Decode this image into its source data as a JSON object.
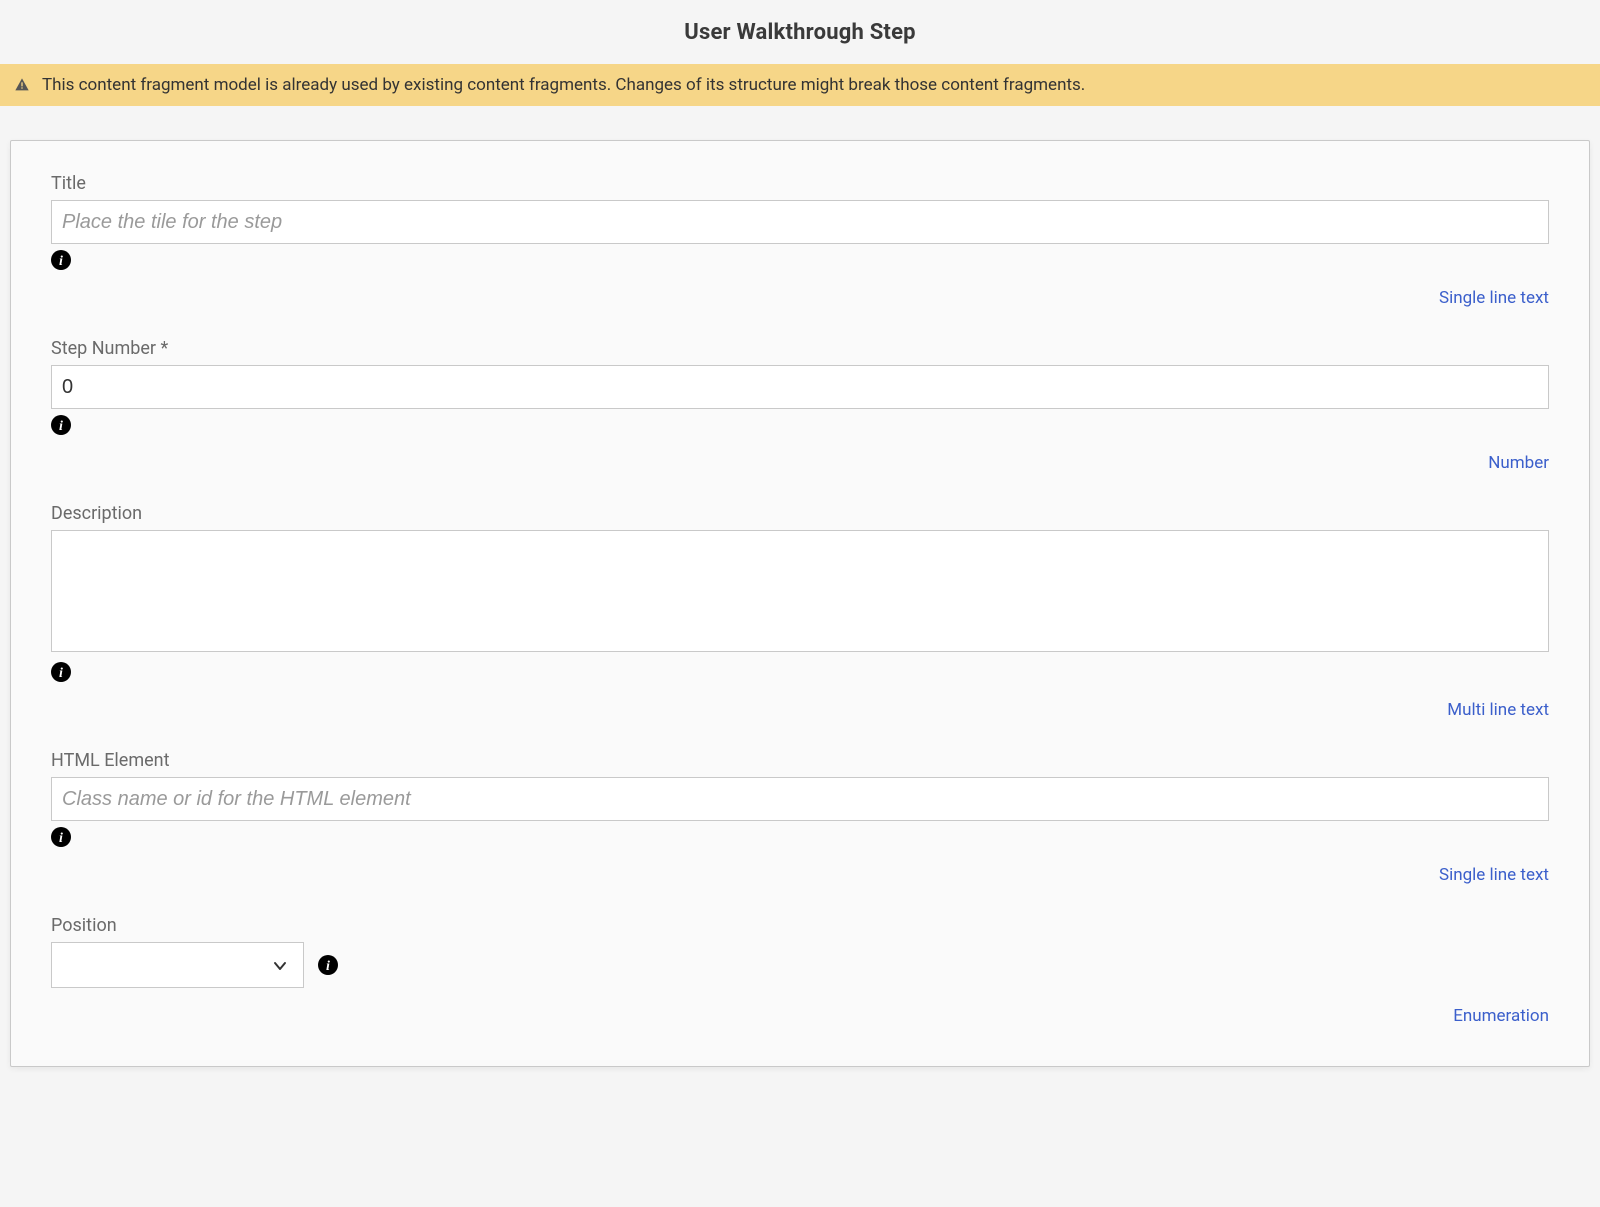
{
  "header": {
    "title": "User Walkthrough Step"
  },
  "warning": {
    "message": "This content fragment model is already used by existing content fragments. Changes of its structure might break those content fragments."
  },
  "fields": {
    "title": {
      "label": "Title",
      "placeholder": "Place the tile for the step",
      "value": "",
      "type_hint": "Single line text"
    },
    "step_number": {
      "label": "Step Number *",
      "value": "0",
      "type_hint": "Number"
    },
    "description": {
      "label": "Description",
      "value": "",
      "type_hint": "Multi line text"
    },
    "html_element": {
      "label": "HTML Element",
      "placeholder": "Class name or id for the HTML element",
      "value": "",
      "type_hint": "Single line text"
    },
    "position": {
      "label": "Position",
      "selected": "",
      "type_hint": "Enumeration"
    }
  }
}
